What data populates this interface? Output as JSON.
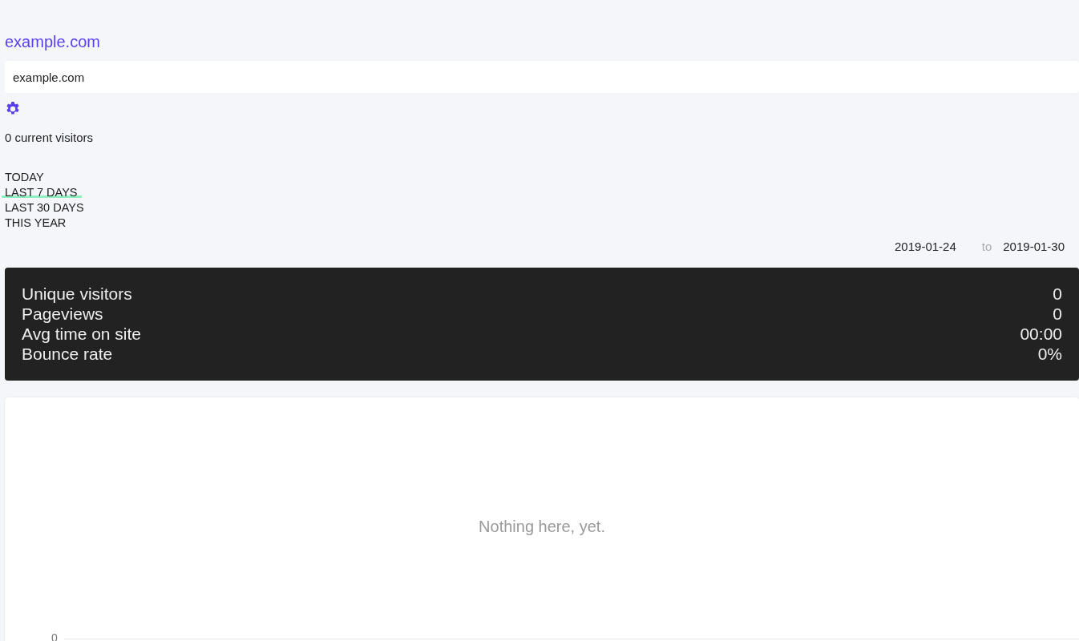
{
  "site_title": "example.com",
  "site_field": {
    "value": "example.com"
  },
  "current_visitors": "0 current visitors",
  "periods": [
    {
      "label": "TODAY",
      "selected": false
    },
    {
      "label": "LAST 7 DAYS",
      "selected": true
    },
    {
      "label": "LAST 30 DAYS",
      "selected": false
    },
    {
      "label": "THIS YEAR",
      "selected": false
    }
  ],
  "date_range": {
    "start": "2019-01-24",
    "separator": "to",
    "end": "2019-01-30"
  },
  "stats": [
    {
      "label": "Unique visitors",
      "value": "0"
    },
    {
      "label": "Pageviews",
      "value": "0"
    },
    {
      "label": "Avg time on site",
      "value": "00:00"
    },
    {
      "label": "Bounce rate",
      "value": "0%"
    }
  ],
  "chart": {
    "empty_message": "Nothing here, yet.",
    "y_axis_label": "0"
  }
}
